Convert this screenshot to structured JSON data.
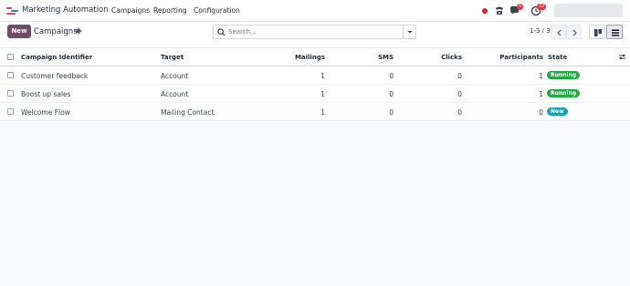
{
  "navbar": {
    "app_name": "Marketing Automation",
    "menus": [
      "Campaigns",
      "Reporting",
      "Configuration"
    ],
    "chat_badge": "5",
    "activity_badge": "22",
    "icons": [
      "record-dot",
      "phone-icon",
      "chat-icon",
      "clock-icon"
    ]
  },
  "control": {
    "new_label": "New",
    "breadcrumb": "Campaigns",
    "search_placeholder": "Search...",
    "pager": "1-3 / 3"
  },
  "table": {
    "columns": [
      "Campaign Identifier",
      "Target",
      "Mailings",
      "SMS",
      "Clicks",
      "Participants",
      "State"
    ],
    "rows": [
      {
        "name": "Customer feedback",
        "target": "Account",
        "mailings": "1",
        "sms": "0",
        "clicks": "0",
        "participants": "1",
        "state": "Running",
        "state_color": "#28a745"
      },
      {
        "name": "Boost up sales",
        "target": "Account",
        "mailings": "1",
        "sms": "0",
        "clicks": "0",
        "participants": "1",
        "state": "Running",
        "state_color": "#28a745"
      },
      {
        "name": "Welcome Flow",
        "target": "Mailing Contact",
        "mailings": "1",
        "sms": "0",
        "clicks": "0",
        "participants": "0",
        "state": "New",
        "state_color": "#17a2b8"
      }
    ]
  },
  "colors": {
    "brand": "#714b67",
    "running": "#28a745",
    "new": "#17a2b8"
  }
}
